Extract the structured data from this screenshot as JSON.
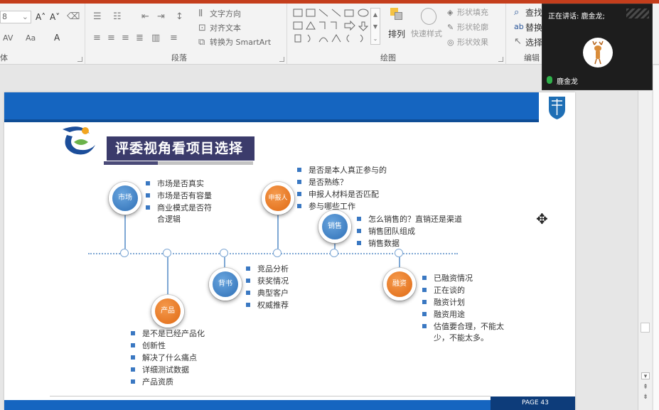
{
  "ribbon": {
    "font_size_value": "8",
    "grow_font": "A˄",
    "shrink_font": "A˅",
    "char_spacing": "AV",
    "change_case": "Aa",
    "font_color": "A",
    "group_font": "体",
    "text_direction": "文字方向",
    "align_text": "对齐文本",
    "convert_smartart": "转换为 SmartArt",
    "group_paragraph": "段落",
    "arrange": "排列",
    "quick_styles": "快速样式",
    "shape_fill": "形状填充",
    "shape_outline": "形状轮廓",
    "shape_effects": "形状效果",
    "group_drawing": "绘图",
    "find": "查找",
    "replace": "替换",
    "select": "选择",
    "group_editing": "编辑"
  },
  "video": {
    "speaking_label": "正在讲话: 鹿金龙;",
    "participant_name": "鹿金龙"
  },
  "slide": {
    "title": "评委视角看项目选择",
    "page_label": "PAGE  43",
    "nodes": {
      "market": "市场",
      "applicant": "申报人",
      "sales": "销售",
      "background": "背书",
      "product": "产品",
      "financing": "融资"
    },
    "market_points": [
      "市场是否真实",
      "市场是否有容量",
      "商业模式是否符",
      "合逻辑"
    ],
    "applicant_points": [
      "是否是本人真正参与的",
      "是否熟练？",
      "申报人材料是否匹配",
      "参与哪些工作"
    ],
    "sales_points": [
      "怎么销售的？直销还是渠道",
      "销售团队组成",
      "销售数据"
    ],
    "background_points": [
      "竞品分析",
      "获奖情况",
      "典型客户",
      "权威推荐"
    ],
    "product_points": [
      "是不是已经产品化",
      "创新性",
      "解决了什么痛点",
      "详细测试数据",
      "产品资质"
    ],
    "financing_points": [
      "已融资情况",
      "正在谈的",
      "融资计划",
      "融资用途",
      "估值要合理，不能太",
      "少，不能太多。"
    ]
  },
  "colors": {
    "slide_blue": "#1565c0",
    "title_bg": "#3b3b6b",
    "node_blue": "#2e6fb6",
    "node_orange": "#e06a14",
    "ribbon_accent": "#c43e1c"
  }
}
